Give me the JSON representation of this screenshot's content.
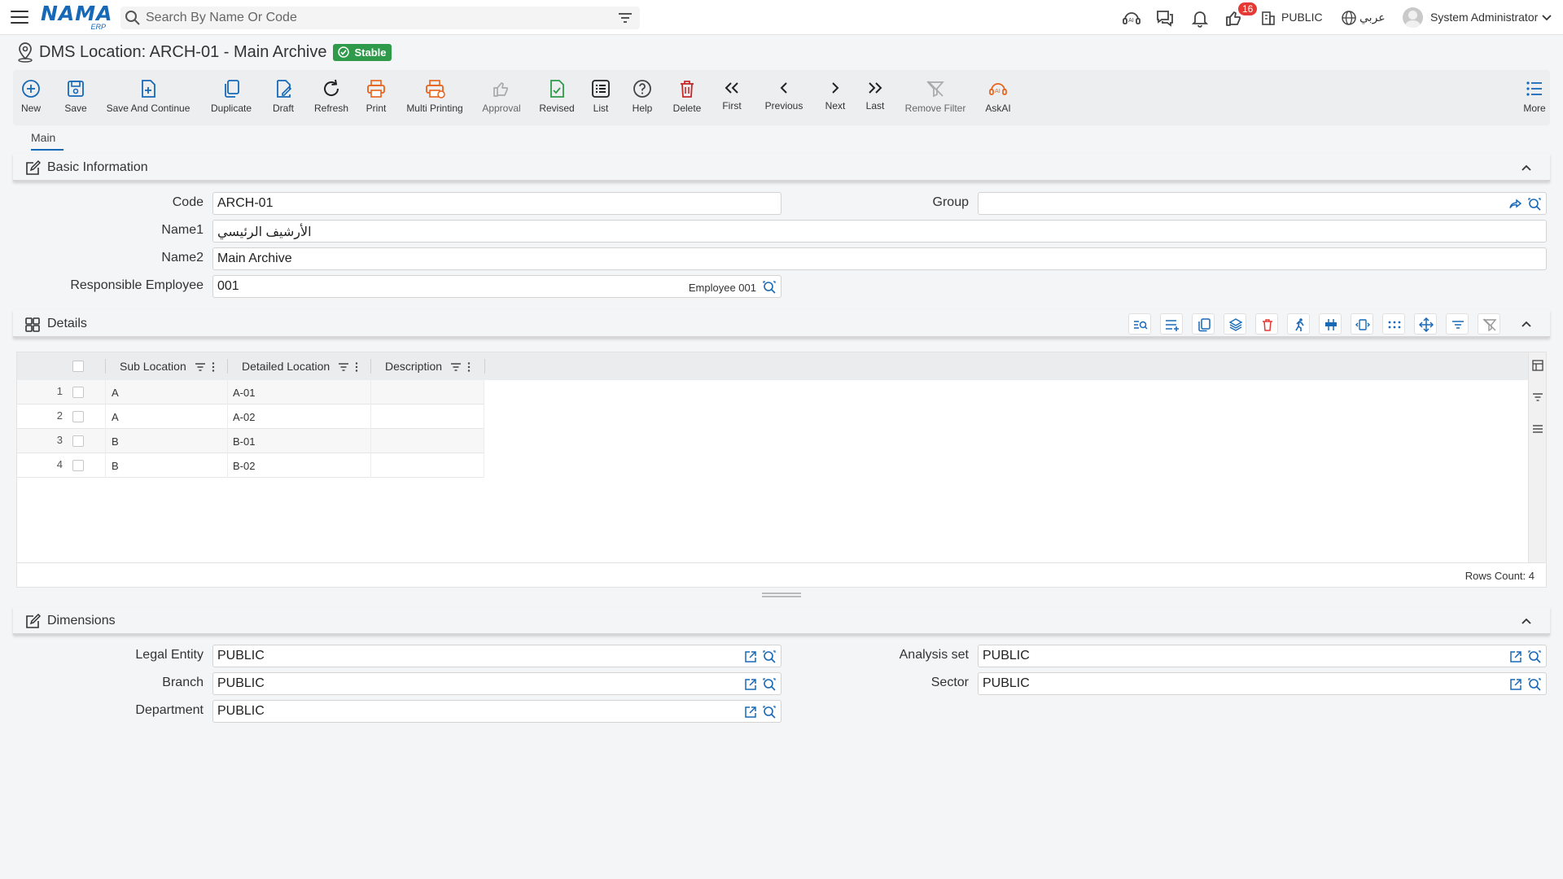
{
  "topbar": {
    "logo": "NAMA",
    "logo_sub": "ERP",
    "search_placeholder": "Search By Name Or Code",
    "notifications_count": "16",
    "entity": "PUBLIC",
    "language": "عربي",
    "user_name": "System Administrator"
  },
  "page": {
    "title": "DMS Location: ARCH-01 - Main Archive",
    "status": "Stable"
  },
  "toolbar": {
    "new": "New",
    "save": "Save",
    "save_continue": "Save And Continue",
    "duplicate": "Duplicate",
    "draft": "Draft",
    "refresh": "Refresh",
    "print": "Print",
    "multi_printing": "Multi Printing",
    "approval": "Approval",
    "revised": "Revised",
    "list": "List",
    "help": "Help",
    "delete": "Delete",
    "first": "First",
    "previous": "Previous",
    "next": "Next",
    "last": "Last",
    "remove_filter": "Remove Filter",
    "askai": "AskAI",
    "more": "More"
  },
  "tabs": [
    {
      "label": "Main"
    }
  ],
  "basic_info": {
    "title": "Basic Information",
    "code_label": "Code",
    "code_value": "ARCH-01",
    "group_label": "Group",
    "group_value": "",
    "name1_label": "Name1",
    "name1_value": "الأرشيف الرئيسي",
    "name2_label": "Name2",
    "name2_value": "Main Archive",
    "employee_label": "Responsible Employee",
    "employee_code": "001",
    "employee_name": "Employee 001"
  },
  "details": {
    "title": "Details",
    "columns": [
      "Sub Location",
      "Detailed Location",
      "Description"
    ],
    "rows": [
      {
        "n": "1",
        "sub": "A",
        "detail": "A-01",
        "desc": ""
      },
      {
        "n": "2",
        "sub": "A",
        "detail": "A-02",
        "desc": ""
      },
      {
        "n": "3",
        "sub": "B",
        "detail": "B-01",
        "desc": ""
      },
      {
        "n": "4",
        "sub": "B",
        "detail": "B-02",
        "desc": ""
      }
    ],
    "rows_count": "Rows Count: 4"
  },
  "dimensions": {
    "title": "Dimensions",
    "legal_entity_label": "Legal Entity",
    "legal_entity_value": "PUBLIC",
    "analysis_set_label": "Analysis set",
    "analysis_set_value": "PUBLIC",
    "branch_label": "Branch",
    "branch_value": "PUBLIC",
    "sector_label": "Sector",
    "sector_value": "PUBLIC",
    "department_label": "Department",
    "department_value": "PUBLIC"
  },
  "colors": {
    "accent": "#1769b8",
    "success": "#2e9a4a",
    "danger": "#c62828",
    "print": "#e8621a"
  }
}
